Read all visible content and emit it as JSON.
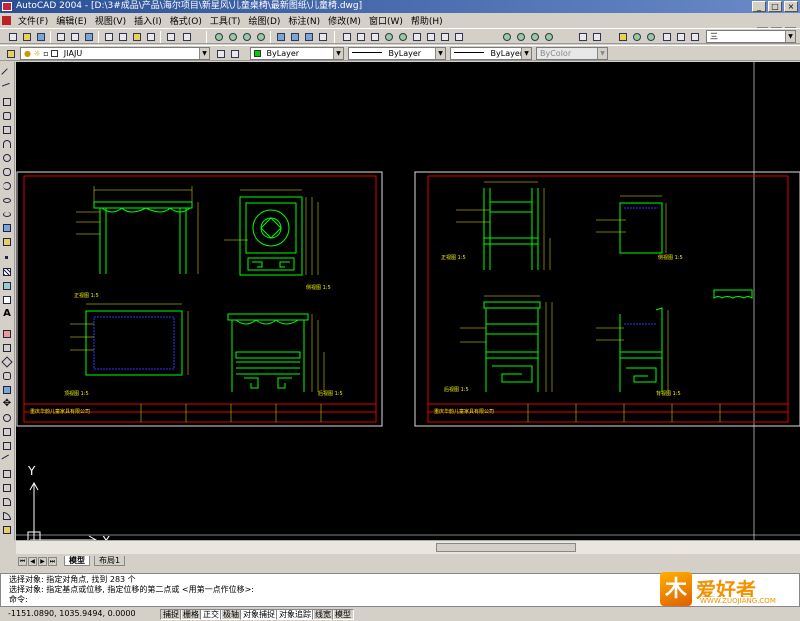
{
  "window": {
    "title": "AutoCAD 2004 - [D:\\3#成品\\产品\\海尔项目\\新星风\\儿童桌椅\\最新图纸\\儿童椅.dwg]"
  },
  "menu": [
    "文件(F)",
    "编辑(E)",
    "视图(V)",
    "插入(I)",
    "格式(O)",
    "工具(T)",
    "绘图(D)",
    "标注(N)",
    "修改(M)",
    "窗口(W)",
    "帮助(H)"
  ],
  "layer_bar": {
    "layer": "JIAJU",
    "color": "ByLayer",
    "linetype": "ByLayer",
    "lineweight": "ByLayer",
    "plotstyle": "ByColor"
  },
  "dimstyle": "三",
  "sheets": {
    "left": {
      "company": "重庆华韵儿童家具有限公司",
      "labels": {
        "front": "正视图 1:5",
        "side": "侧视图 1:5",
        "top": "顶视图 1:5",
        "back": "后视图 1:5"
      }
    },
    "right": {
      "company": "重庆华韵儿童家具有限公司",
      "labels": {
        "front": "正视图 1:5",
        "side": "侧视图 1:5",
        "back": "后视图 1:5",
        "detail": "背视图 1:5"
      }
    }
  },
  "ucs": {
    "x": "X",
    "y": "Y"
  },
  "tabs": [
    "模型",
    "布局1"
  ],
  "command": {
    "line1": "选择对象: 指定对角点, 找到 283 个",
    "line2": "选择对象: 指定基点或位移, 指定位移的第二点或 <用第一点作位移>:",
    "prompt": "命令:"
  },
  "status": {
    "coords": "-1151.0890, 1035.9494, 0.0000",
    "buttons": [
      "捕捉",
      "栅格",
      "正交",
      "极轴",
      "对象捕捉",
      "对象追踪",
      "线宽",
      "模型"
    ]
  },
  "watermark": {
    "text": "爱好者",
    "url": "WWW.ZUOJIANG.COM"
  }
}
